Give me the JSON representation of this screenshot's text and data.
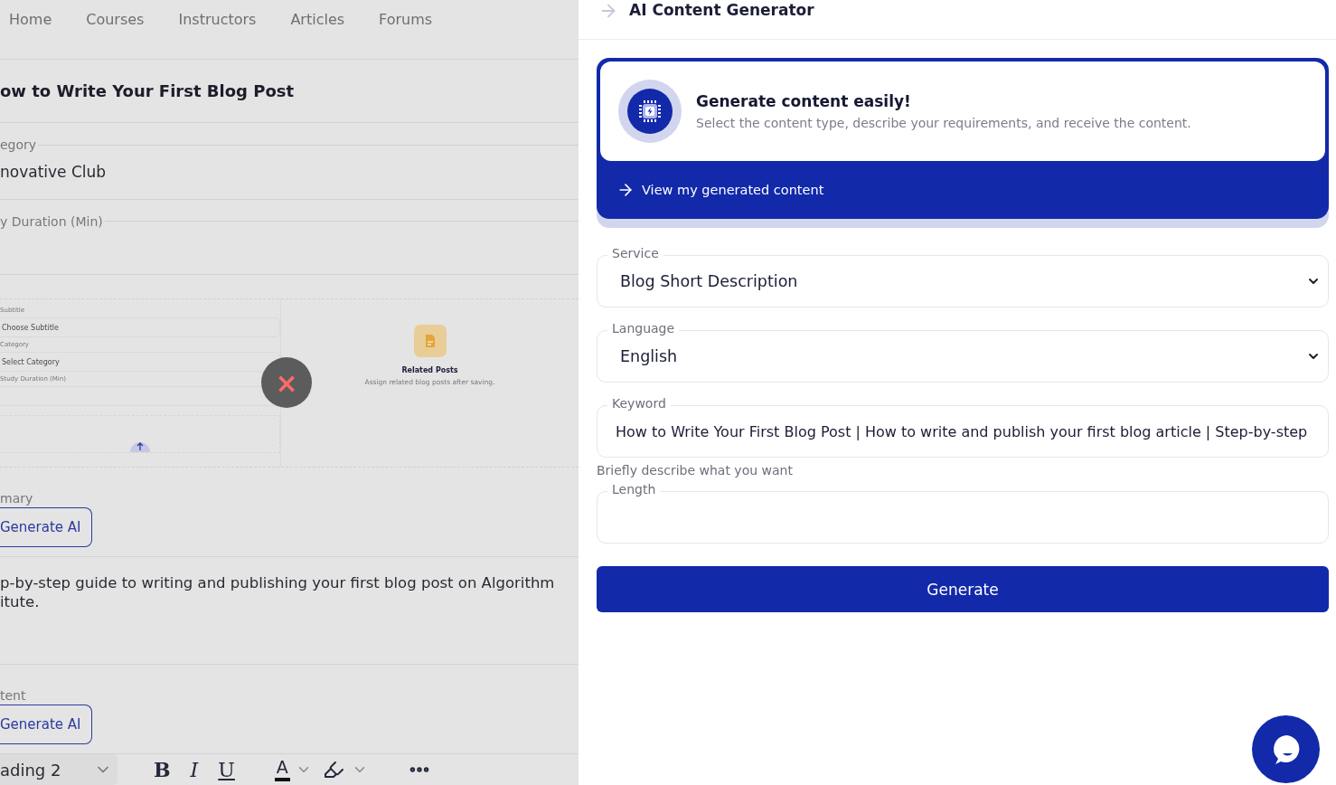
{
  "background_page": {
    "nav": [
      "Home",
      "Courses",
      "Instructors",
      "Articles",
      "Forums"
    ],
    "post_title": "ow to Write Your First Blog Post",
    "fields": [
      {
        "legend": "egory",
        "value": "novative Club"
      },
      {
        "legend": "y Duration (Min)"
      }
    ],
    "preview": {
      "fields": [
        {
          "label": "Subtitle",
          "value": "Choose Subtitle"
        },
        {
          "label": "Category",
          "value": "Select Category"
        },
        {
          "label": "Study Duration (Min)"
        }
      ],
      "close": "×",
      "related": {
        "title": "Related Posts",
        "text": "Assign related blog posts after saving."
      }
    },
    "ai_sections": [
      {
        "legend": "mary",
        "button": "Generate AI",
        "text": "p-by-step guide to writing and publishing your first blog post on Algorithm\nitute."
      },
      {
        "legend": "tent",
        "button": "Generate AI"
      }
    ],
    "toolbar": {
      "block_style": "ading 2",
      "formats": [
        {
          "kind": "bold",
          "glyph": "B"
        },
        {
          "kind": "italic",
          "glyph": "I"
        },
        {
          "kind": "underline",
          "glyph": "U"
        }
      ],
      "text_color": "A"
    }
  },
  "panel": {
    "title": "AI Content Generator",
    "intro": {
      "heading": "Generate content easily!",
      "text": "Select the content type, describe your requirements, and receive the content.",
      "link": "View my generated content"
    },
    "fields": [
      {
        "kind": "select",
        "label": "Service",
        "value": "Blog Short Description"
      },
      {
        "kind": "select",
        "label": "Language",
        "value": "English"
      },
      {
        "kind": "input",
        "label": "Keyword",
        "value": "How to Write Your First Blog Post | How to write and publish your first blog article | Step-by-step",
        "hint": "Briefly describe what you want"
      },
      {
        "kind": "input",
        "label": "Length"
      }
    ],
    "submit": "Generate"
  }
}
